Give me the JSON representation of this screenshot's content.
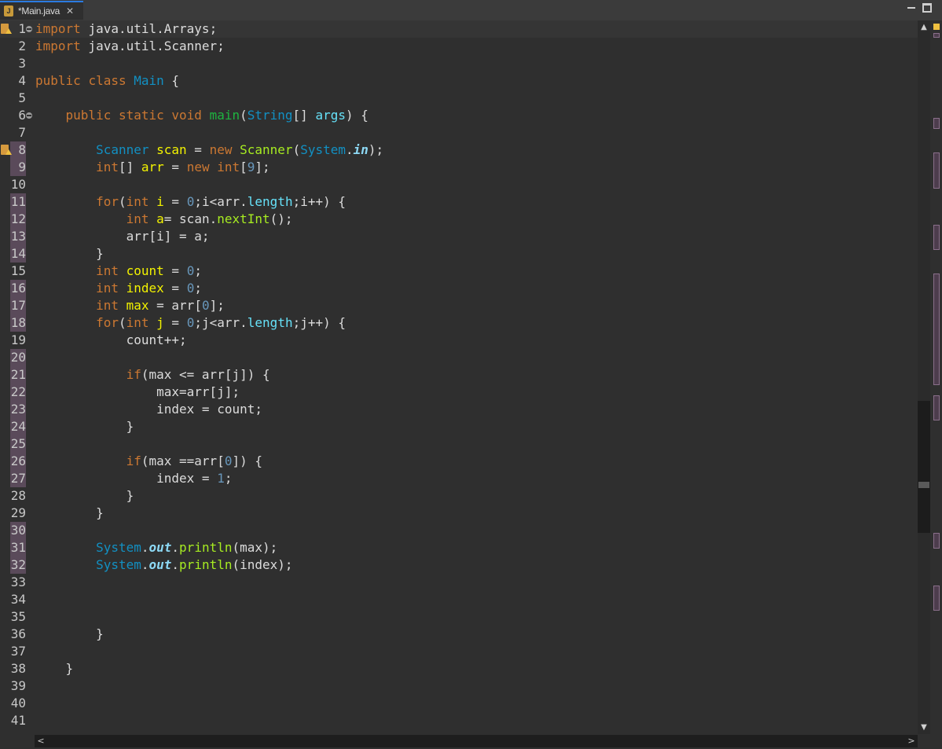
{
  "tab": {
    "title": "*Main.java",
    "icon": "java-file-icon",
    "close": "✕"
  },
  "window": {
    "minimize_icon": "minimize-icon",
    "maximize_icon": "maximize-icon"
  },
  "lines": [
    {
      "n": "1",
      "tokens": [
        [
          "k",
          "import"
        ],
        [
          "p",
          " "
        ],
        [
          "p",
          "java.util.Arrays;"
        ]
      ],
      "cur": true,
      "warn": true,
      "fold": true
    },
    {
      "n": "2",
      "tokens": [
        [
          "k",
          "import"
        ],
        [
          "p",
          " java.util.Scanner;"
        ]
      ]
    },
    {
      "n": "3",
      "tokens": []
    },
    {
      "n": "4",
      "tokens": [
        [
          "k",
          "public"
        ],
        [
          "p",
          " "
        ],
        [
          "k",
          "class"
        ],
        [
          "p",
          " "
        ],
        [
          "t",
          "Main"
        ],
        [
          "p",
          " {"
        ]
      ]
    },
    {
      "n": "5",
      "tokens": []
    },
    {
      "n": "6",
      "tokens": [
        [
          "p",
          "    "
        ],
        [
          "k",
          "public"
        ],
        [
          "p",
          " "
        ],
        [
          "k",
          "static"
        ],
        [
          "p",
          " "
        ],
        [
          "k",
          "void"
        ],
        [
          "p",
          " "
        ],
        [
          "f",
          "main"
        ],
        [
          "p",
          "("
        ],
        [
          "t",
          "String"
        ],
        [
          "p",
          "[] "
        ],
        [
          "fld",
          "args"
        ],
        [
          "p",
          ") {"
        ]
      ],
      "fold": true
    },
    {
      "n": "7",
      "tokens": []
    },
    {
      "n": "8",
      "tokens": [
        [
          "p",
          "        "
        ],
        [
          "t",
          "Scanner"
        ],
        [
          "p",
          " "
        ],
        [
          "v",
          "scan"
        ],
        [
          "p",
          " = "
        ],
        [
          "k",
          "new"
        ],
        [
          "p",
          " "
        ],
        [
          "m",
          "Scanner"
        ],
        [
          "p",
          "("
        ],
        [
          "t",
          "System"
        ],
        [
          "p",
          "."
        ],
        [
          "sf",
          "in"
        ],
        [
          "p",
          ");"
        ]
      ],
      "warn": true,
      "mark": true
    },
    {
      "n": "9",
      "tokens": [
        [
          "p",
          "        "
        ],
        [
          "k",
          "int"
        ],
        [
          "p",
          "[] "
        ],
        [
          "v",
          "arr"
        ],
        [
          "p",
          " = "
        ],
        [
          "k",
          "new"
        ],
        [
          "p",
          " "
        ],
        [
          "k",
          "int"
        ],
        [
          "p",
          "["
        ],
        [
          "n",
          "9"
        ],
        [
          "p",
          "];"
        ]
      ],
      "mark": true
    },
    {
      "n": "10",
      "tokens": []
    },
    {
      "n": "11",
      "tokens": [
        [
          "p",
          "        "
        ],
        [
          "k",
          "for"
        ],
        [
          "p",
          "("
        ],
        [
          "k",
          "int"
        ],
        [
          "p",
          " "
        ],
        [
          "v",
          "i"
        ],
        [
          "p",
          " = "
        ],
        [
          "n",
          "0"
        ],
        [
          "p",
          ";i<arr."
        ],
        [
          "fld",
          "length"
        ],
        [
          "p",
          ";i++) {"
        ]
      ],
      "mark": true
    },
    {
      "n": "12",
      "tokens": [
        [
          "p",
          "            "
        ],
        [
          "k",
          "int"
        ],
        [
          "p",
          " "
        ],
        [
          "v",
          "a"
        ],
        [
          "p",
          "= scan."
        ],
        [
          "m",
          "nextInt"
        ],
        [
          "p",
          "();"
        ]
      ],
      "mark": true
    },
    {
      "n": "13",
      "tokens": [
        [
          "p",
          "            arr[i] = a;"
        ]
      ],
      "mark": true
    },
    {
      "n": "14",
      "tokens": [
        [
          "p",
          "        }"
        ]
      ],
      "mark": true
    },
    {
      "n": "15",
      "tokens": [
        [
          "p",
          "        "
        ],
        [
          "k",
          "int"
        ],
        [
          "p",
          " "
        ],
        [
          "v",
          "count"
        ],
        [
          "p",
          " = "
        ],
        [
          "n",
          "0"
        ],
        [
          "p",
          ";"
        ]
      ]
    },
    {
      "n": "16",
      "tokens": [
        [
          "p",
          "        "
        ],
        [
          "k",
          "int"
        ],
        [
          "p",
          " "
        ],
        [
          "v",
          "index"
        ],
        [
          "p",
          " = "
        ],
        [
          "n",
          "0"
        ],
        [
          "p",
          ";"
        ]
      ],
      "mark": true
    },
    {
      "n": "17",
      "tokens": [
        [
          "p",
          "        "
        ],
        [
          "k",
          "int"
        ],
        [
          "p",
          " "
        ],
        [
          "v",
          "max"
        ],
        [
          "p",
          " = arr["
        ],
        [
          "n",
          "0"
        ],
        [
          "p",
          "];"
        ]
      ],
      "mark": true
    },
    {
      "n": "18",
      "tokens": [
        [
          "p",
          "        "
        ],
        [
          "k",
          "for"
        ],
        [
          "p",
          "("
        ],
        [
          "k",
          "int"
        ],
        [
          "p",
          " "
        ],
        [
          "v",
          "j"
        ],
        [
          "p",
          " = "
        ],
        [
          "n",
          "0"
        ],
        [
          "p",
          ";j<arr."
        ],
        [
          "fld",
          "length"
        ],
        [
          "p",
          ";j++) {"
        ]
      ],
      "mark": true
    },
    {
      "n": "19",
      "tokens": [
        [
          "p",
          "            count++;"
        ]
      ]
    },
    {
      "n": "20",
      "tokens": [],
      "mark": true
    },
    {
      "n": "21",
      "tokens": [
        [
          "p",
          "            "
        ],
        [
          "k",
          "if"
        ],
        [
          "p",
          "(max <= arr[j]) {"
        ]
      ],
      "mark": true
    },
    {
      "n": "22",
      "tokens": [
        [
          "p",
          "                max=arr[j];"
        ]
      ],
      "mark": true
    },
    {
      "n": "23",
      "tokens": [
        [
          "p",
          "                index = count;"
        ]
      ],
      "mark": true
    },
    {
      "n": "24",
      "tokens": [
        [
          "p",
          "            }"
        ]
      ],
      "mark": true
    },
    {
      "n": "25",
      "tokens": [],
      "mark": true
    },
    {
      "n": "26",
      "tokens": [
        [
          "p",
          "            "
        ],
        [
          "k",
          "if"
        ],
        [
          "p",
          "(max ==arr["
        ],
        [
          "n",
          "0"
        ],
        [
          "p",
          "]) {"
        ]
      ],
      "mark": true
    },
    {
      "n": "27",
      "tokens": [
        [
          "p",
          "                index = "
        ],
        [
          "n",
          "1"
        ],
        [
          "p",
          ";"
        ]
      ],
      "mark": true
    },
    {
      "n": "28",
      "tokens": [
        [
          "p",
          "            }"
        ]
      ]
    },
    {
      "n": "29",
      "tokens": [
        [
          "p",
          "        }"
        ]
      ]
    },
    {
      "n": "30",
      "tokens": [],
      "mark": true
    },
    {
      "n": "31",
      "tokens": [
        [
          "p",
          "        "
        ],
        [
          "t",
          "System"
        ],
        [
          "p",
          "."
        ],
        [
          "sf",
          "out"
        ],
        [
          "p",
          "."
        ],
        [
          "m",
          "println"
        ],
        [
          "p",
          "(max);"
        ]
      ],
      "mark": true
    },
    {
      "n": "32",
      "tokens": [
        [
          "p",
          "        "
        ],
        [
          "t",
          "System"
        ],
        [
          "p",
          "."
        ],
        [
          "sf",
          "out"
        ],
        [
          "p",
          "."
        ],
        [
          "m",
          "println"
        ],
        [
          "p",
          "(index);"
        ]
      ],
      "mark": true
    },
    {
      "n": "33",
      "tokens": []
    },
    {
      "n": "34",
      "tokens": []
    },
    {
      "n": "35",
      "tokens": []
    },
    {
      "n": "36",
      "tokens": [
        [
          "p",
          "        }"
        ]
      ]
    },
    {
      "n": "37",
      "tokens": []
    },
    {
      "n": "38",
      "tokens": [
        [
          "p",
          "    }"
        ]
      ]
    },
    {
      "n": "39",
      "tokens": []
    },
    {
      "n": "40",
      "tokens": []
    },
    {
      "n": "41",
      "tokens": []
    }
  ],
  "scroll": {
    "up": "▲",
    "down": "▼",
    "left": "<",
    "right": ">"
  }
}
